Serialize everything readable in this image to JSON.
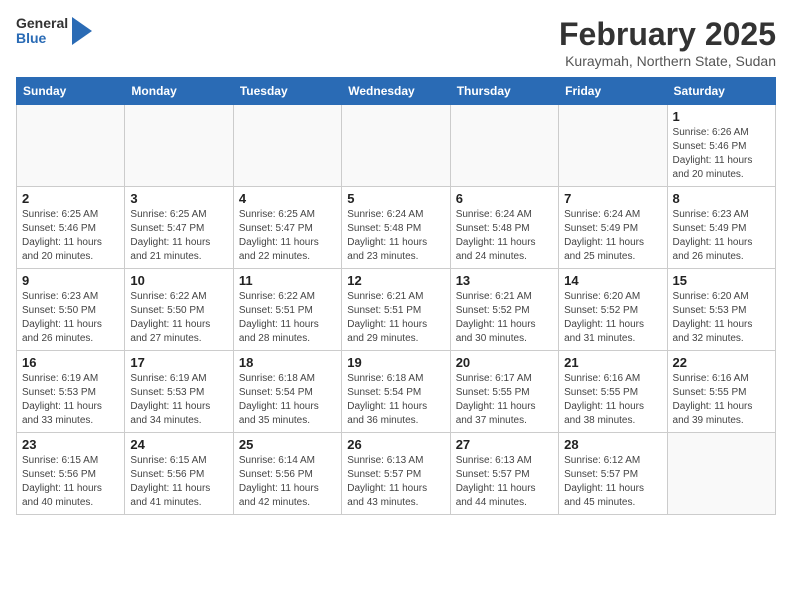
{
  "logo": {
    "general": "General",
    "blue": "Blue"
  },
  "title": "February 2025",
  "location": "Kuraymah, Northern State, Sudan",
  "days_of_week": [
    "Sunday",
    "Monday",
    "Tuesday",
    "Wednesday",
    "Thursday",
    "Friday",
    "Saturday"
  ],
  "weeks": [
    [
      {
        "day": "",
        "info": ""
      },
      {
        "day": "",
        "info": ""
      },
      {
        "day": "",
        "info": ""
      },
      {
        "day": "",
        "info": ""
      },
      {
        "day": "",
        "info": ""
      },
      {
        "day": "",
        "info": ""
      },
      {
        "day": "1",
        "info": "Sunrise: 6:26 AM\nSunset: 5:46 PM\nDaylight: 11 hours and 20 minutes."
      }
    ],
    [
      {
        "day": "2",
        "info": "Sunrise: 6:25 AM\nSunset: 5:46 PM\nDaylight: 11 hours and 20 minutes."
      },
      {
        "day": "3",
        "info": "Sunrise: 6:25 AM\nSunset: 5:47 PM\nDaylight: 11 hours and 21 minutes."
      },
      {
        "day": "4",
        "info": "Sunrise: 6:25 AM\nSunset: 5:47 PM\nDaylight: 11 hours and 22 minutes."
      },
      {
        "day": "5",
        "info": "Sunrise: 6:24 AM\nSunset: 5:48 PM\nDaylight: 11 hours and 23 minutes."
      },
      {
        "day": "6",
        "info": "Sunrise: 6:24 AM\nSunset: 5:48 PM\nDaylight: 11 hours and 24 minutes."
      },
      {
        "day": "7",
        "info": "Sunrise: 6:24 AM\nSunset: 5:49 PM\nDaylight: 11 hours and 25 minutes."
      },
      {
        "day": "8",
        "info": "Sunrise: 6:23 AM\nSunset: 5:49 PM\nDaylight: 11 hours and 26 minutes."
      }
    ],
    [
      {
        "day": "9",
        "info": "Sunrise: 6:23 AM\nSunset: 5:50 PM\nDaylight: 11 hours and 26 minutes."
      },
      {
        "day": "10",
        "info": "Sunrise: 6:22 AM\nSunset: 5:50 PM\nDaylight: 11 hours and 27 minutes."
      },
      {
        "day": "11",
        "info": "Sunrise: 6:22 AM\nSunset: 5:51 PM\nDaylight: 11 hours and 28 minutes."
      },
      {
        "day": "12",
        "info": "Sunrise: 6:21 AM\nSunset: 5:51 PM\nDaylight: 11 hours and 29 minutes."
      },
      {
        "day": "13",
        "info": "Sunrise: 6:21 AM\nSunset: 5:52 PM\nDaylight: 11 hours and 30 minutes."
      },
      {
        "day": "14",
        "info": "Sunrise: 6:20 AM\nSunset: 5:52 PM\nDaylight: 11 hours and 31 minutes."
      },
      {
        "day": "15",
        "info": "Sunrise: 6:20 AM\nSunset: 5:53 PM\nDaylight: 11 hours and 32 minutes."
      }
    ],
    [
      {
        "day": "16",
        "info": "Sunrise: 6:19 AM\nSunset: 5:53 PM\nDaylight: 11 hours and 33 minutes."
      },
      {
        "day": "17",
        "info": "Sunrise: 6:19 AM\nSunset: 5:53 PM\nDaylight: 11 hours and 34 minutes."
      },
      {
        "day": "18",
        "info": "Sunrise: 6:18 AM\nSunset: 5:54 PM\nDaylight: 11 hours and 35 minutes."
      },
      {
        "day": "19",
        "info": "Sunrise: 6:18 AM\nSunset: 5:54 PM\nDaylight: 11 hours and 36 minutes."
      },
      {
        "day": "20",
        "info": "Sunrise: 6:17 AM\nSunset: 5:55 PM\nDaylight: 11 hours and 37 minutes."
      },
      {
        "day": "21",
        "info": "Sunrise: 6:16 AM\nSunset: 5:55 PM\nDaylight: 11 hours and 38 minutes."
      },
      {
        "day": "22",
        "info": "Sunrise: 6:16 AM\nSunset: 5:55 PM\nDaylight: 11 hours and 39 minutes."
      }
    ],
    [
      {
        "day": "23",
        "info": "Sunrise: 6:15 AM\nSunset: 5:56 PM\nDaylight: 11 hours and 40 minutes."
      },
      {
        "day": "24",
        "info": "Sunrise: 6:15 AM\nSunset: 5:56 PM\nDaylight: 11 hours and 41 minutes."
      },
      {
        "day": "25",
        "info": "Sunrise: 6:14 AM\nSunset: 5:56 PM\nDaylight: 11 hours and 42 minutes."
      },
      {
        "day": "26",
        "info": "Sunrise: 6:13 AM\nSunset: 5:57 PM\nDaylight: 11 hours and 43 minutes."
      },
      {
        "day": "27",
        "info": "Sunrise: 6:13 AM\nSunset: 5:57 PM\nDaylight: 11 hours and 44 minutes."
      },
      {
        "day": "28",
        "info": "Sunrise: 6:12 AM\nSunset: 5:57 PM\nDaylight: 11 hours and 45 minutes."
      },
      {
        "day": "",
        "info": ""
      }
    ]
  ]
}
